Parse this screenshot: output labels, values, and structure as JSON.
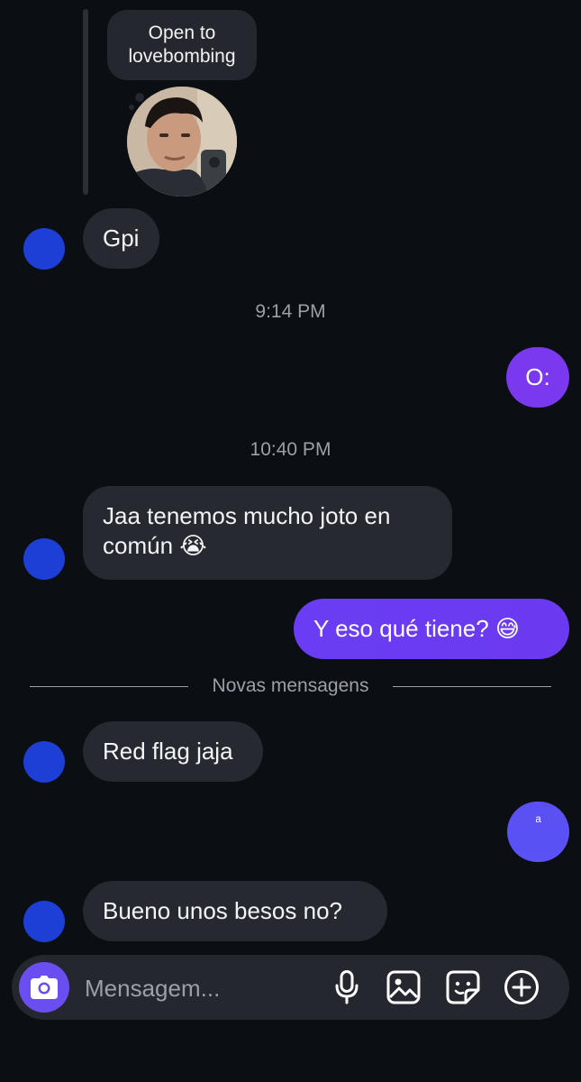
{
  "note": {
    "text": "Open to lovebombing"
  },
  "messages": [
    {
      "text": "Gpi"
    },
    {
      "text": "9:14 PM"
    },
    {
      "text": "O:"
    },
    {
      "text": "10:40 PM"
    },
    {
      "text": "Jaa tenemos mucho joto en común 😭"
    },
    {
      "text": "Y eso qué tiene? 😅"
    },
    {
      "text": "Red flag jaja"
    },
    {
      "text": "ᵃ"
    },
    {
      "text": "Bueno unos besos no?"
    }
  ],
  "divider": {
    "label": "Novas mensagens"
  },
  "composer": {
    "placeholder": "Mensagem..."
  },
  "icons": [
    "camera-icon",
    "microphone-icon",
    "gallery-icon",
    "sticker-icon",
    "plus-icon"
  ],
  "colors": {
    "background": "#0b0e13",
    "incoming_bubble": "#262a30",
    "outgoing_bubble": "#6d36f2",
    "avatar": "#1d3fd6"
  }
}
